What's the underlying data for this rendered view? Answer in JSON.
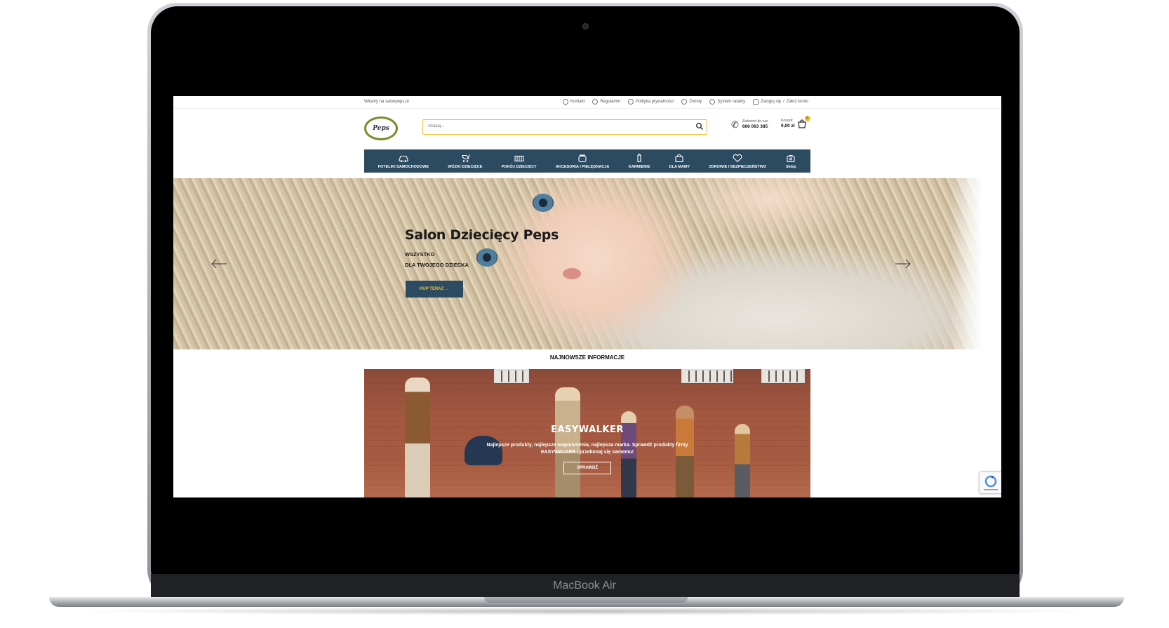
{
  "device": {
    "label": "MacBook Air"
  },
  "topbar": {
    "welcome": "Witamy na salonpeps.pl",
    "links": [
      {
        "label": "Kontakt",
        "icon": "location-pin-icon"
      },
      {
        "label": "Regulamin",
        "icon": "info-icon"
      },
      {
        "label": "Polityka prywatności",
        "icon": "info-icon"
      },
      {
        "label": "Zwroty",
        "icon": "info-icon"
      },
      {
        "label": "System ratalny",
        "icon": "info-icon"
      }
    ],
    "login": "Zaloguj się",
    "separator": "/",
    "register": "Załóż konto"
  },
  "header": {
    "logo_text": "Peps",
    "search_placeholder": "Szukaj...",
    "phone_caption": "Zadzwoń do nas",
    "phone_number": "666 063 385",
    "cart_caption": "Koszyk:",
    "cart_total": "0,00 zł",
    "cart_count": "0"
  },
  "nav": [
    {
      "label": "FOTELIKI SAMOCHODOWE",
      "icon": "car-icon"
    },
    {
      "label": "WÓZKI DZIECIĘCE",
      "icon": "stroller-icon"
    },
    {
      "label": "POKÓJ DZIECIĘCY",
      "icon": "bed-icon"
    },
    {
      "label": "AKCESORIA I PIELĘGNACJA",
      "icon": "jar-icon"
    },
    {
      "label": "KARMIENIE",
      "icon": "baby-bottle-icon"
    },
    {
      "label": "DLA MAMY",
      "icon": "bag-icon"
    },
    {
      "label": "ZDROWIE I BEZPIECZEŃSTWO",
      "icon": "heart-icon"
    },
    {
      "label": "Sklep",
      "icon": "shop-bag-icon"
    }
  ],
  "hero": {
    "title": "Salon Dziecięcy Peps",
    "line1": "WSZYSTKO",
    "line2": "DLA TWOJEGO DZIECKA",
    "button": "KUP TERAZ →"
  },
  "news": {
    "title": "NAJNOWSZE INFORMACJE",
    "banner_title": "EASYWALKER",
    "banner_text": "Najlepsze produkty, najlepsze wspomnienia, najlepsza marka. Sprawdź produkty firmy EASYWALKER i przekonaj się samemu!",
    "banner_button": "SPRAWDŹ"
  },
  "colors": {
    "navy": "#2c4a60",
    "accent": "#f2c12e",
    "logo_green": "#7b8c2a"
  }
}
